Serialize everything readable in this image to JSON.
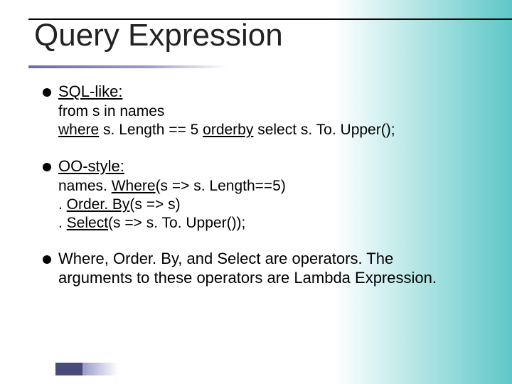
{
  "title": "Query Expression",
  "bullets": [
    {
      "heading": "SQL-like:",
      "lines": [
        {
          "segments": [
            {
              "t": "from s in names",
              "u": false
            }
          ]
        },
        {
          "segments": [
            {
              "t": "where",
              "u": true
            },
            {
              "t": " s. Length == 5 ",
              "u": false
            },
            {
              "t": "orderby",
              "u": true
            },
            {
              "t": " select s. To. Upper();",
              "u": false
            }
          ]
        }
      ]
    },
    {
      "heading": "OO-style:",
      "lines": [
        {
          "segments": [
            {
              "t": "names. ",
              "u": false
            },
            {
              "t": "Where",
              "u": true
            },
            {
              "t": "(s => s. Length==5)",
              "u": false
            }
          ]
        },
        {
          "segments": [
            {
              "t": ". ",
              "u": false
            },
            {
              "t": "Order. By",
              "u": true
            },
            {
              "t": "(s => s)",
              "u": false
            }
          ]
        },
        {
          "segments": [
            {
              "t": ". ",
              "u": false
            },
            {
              "t": "Select",
              "u": true
            },
            {
              "t": "(s => s. To. Upper());",
              "u": false
            }
          ]
        }
      ]
    },
    {
      "heading": "",
      "body": "Where, Order. By, and Select are operators. The arguments to these operators are Lambda Expression."
    }
  ]
}
